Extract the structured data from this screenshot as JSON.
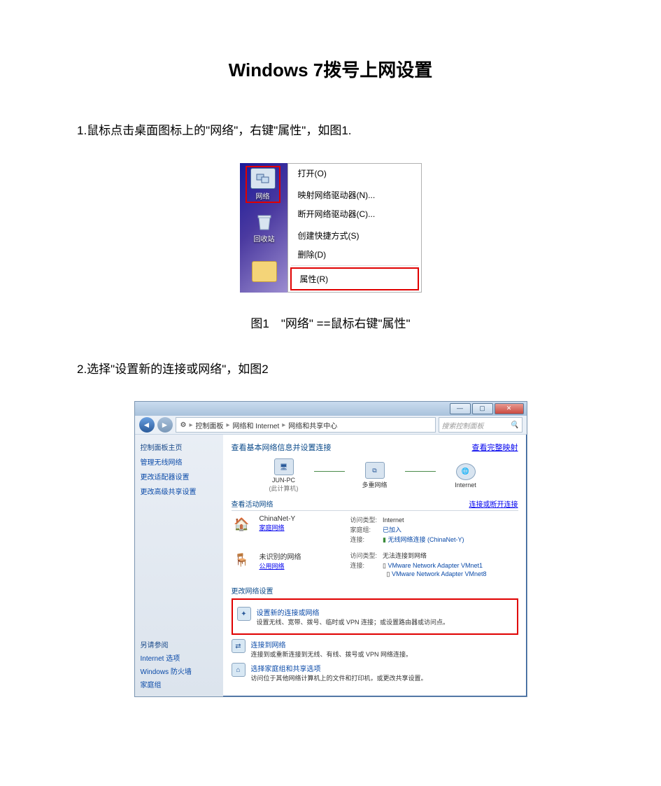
{
  "title": "Windows 7拨号上网设置",
  "step1": "1.鼠标点击桌面图标上的\"网络\"，右键\"属性\"，如图1.",
  "caption1": "图1　\"网络\" ==鼠标右键\"属性\"",
  "step2": "2.选择\"设置新的连接或网络\"，如图2",
  "fig1": {
    "iconNetwork": "网络",
    "iconRecycle": "回收站",
    "menu": {
      "open": "打开(O)",
      "map": "映射网络驱动器(N)...",
      "disconnect": "断开网络驱动器(C)...",
      "shortcut": "创建快捷方式(S)",
      "delete": "删除(D)",
      "properties": "属性(R)"
    }
  },
  "fig2": {
    "winMin": "—",
    "winMax": "▢",
    "winClose": "✕",
    "navBack": "◄",
    "navFwd": "►",
    "crumb1": "控制面板",
    "crumb2": "网络和 Internet",
    "crumb3": "网络和共享中心",
    "searchPlaceholder": "搜索控制面板",
    "sidebar": {
      "header": "控制面板主页",
      "link1": "管理无线网络",
      "link2": "更改适配器设置",
      "link3": "更改高级共享设置",
      "alsoHeader": "另请参阅",
      "also1": "Internet 选项",
      "also2": "Windows 防火墙",
      "also3": "家庭组"
    },
    "content": {
      "heading": "查看基本网络信息并设置连接",
      "fullMap": "查看完整映射",
      "node1": "JUN-PC",
      "node1sub": "(此计算机)",
      "node2": "多重网络",
      "node3": "Internet",
      "activeHeader": "查看活动网络",
      "connectDisc": "连接或断开连接",
      "net1": {
        "name": "ChinaNet-Y",
        "type": "家庭网络",
        "accessLabel": "访问类型:",
        "accessVal": "Internet",
        "homeLabel": "家庭组:",
        "homeVal": "已加入",
        "connLabel": "连接:",
        "connVal": "无线网络连接 (ChinaNet-Y)"
      },
      "net2": {
        "name": "未识别的网络",
        "type": "公用网络",
        "accessLabel": "访问类型:",
        "accessVal": "无法连接到网络",
        "connLabel": "连接:",
        "connVal1": "VMware Network Adapter VMnet1",
        "connVal2": "VMware Network Adapter VMnet8"
      },
      "changeHeader": "更改网络设置",
      "action1": {
        "title": "设置新的连接或网络",
        "desc": "设置无线、宽带、拨号、临时或 VPN 连接；或设置路由器或访问点。"
      },
      "action2": {
        "title": "连接到网络",
        "desc": "连接到或重新连接到无线、有线、拨号或 VPN 网络连接。"
      },
      "action3": {
        "title": "选择家庭组和共享选项",
        "desc": "访问位于其他网络计算机上的文件和打印机，或更改共享设置。"
      }
    }
  }
}
